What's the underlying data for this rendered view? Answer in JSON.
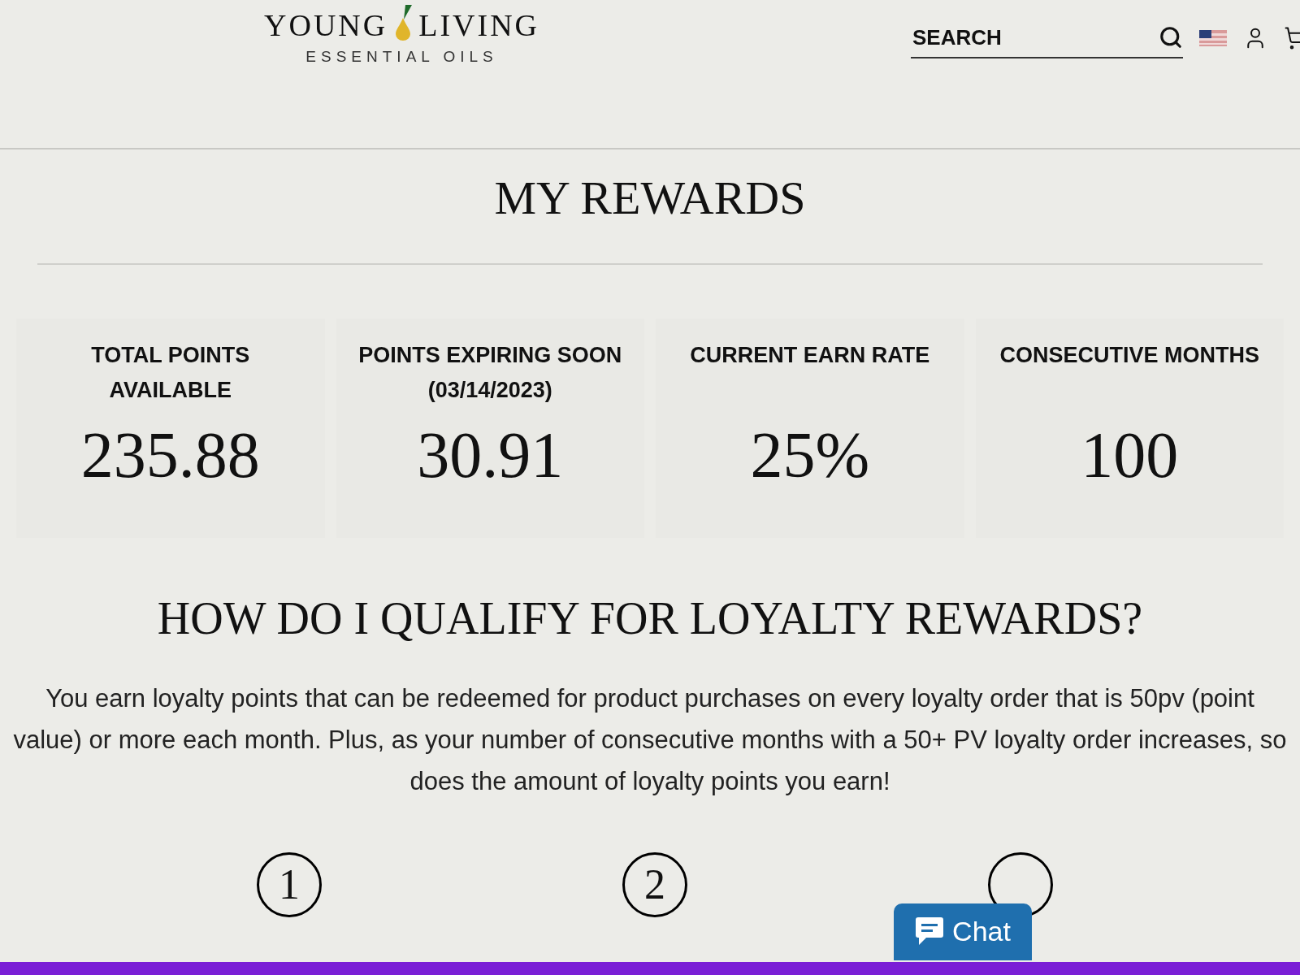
{
  "header": {
    "logo": {
      "brand_left": "YOUNG",
      "brand_right": "LIVING",
      "tagline": "ESSENTIAL OILS"
    },
    "search": {
      "placeholder": "SEARCH"
    }
  },
  "title": "MY REWARDS",
  "stats": [
    {
      "label": "TOTAL POINTS AVAILABLE",
      "value": "235.88"
    },
    {
      "label": "POINTS EXPIRING SOON (03/14/2023)",
      "value": "30.91"
    },
    {
      "label": "CURRENT EARN RATE",
      "value": "25%"
    },
    {
      "label": "CONSECUTIVE MONTHS",
      "value": "100"
    }
  ],
  "qualify": {
    "heading": "HOW DO I QUALIFY FOR LOYALTY REWARDS?",
    "text": "You earn loyalty points that can be redeemed for product purchases on every loyalty order that is 50pv (point value) or more each month. Plus, as your number of consecutive months with a 50+ PV loyalty order increases, so does the amount of loyalty points you earn!"
  },
  "steps": [
    {
      "kind": "numbered",
      "number": "1"
    },
    {
      "kind": "numbered",
      "number": "2"
    },
    {
      "kind": "covered"
    }
  ],
  "chat": {
    "label": "Chat"
  }
}
